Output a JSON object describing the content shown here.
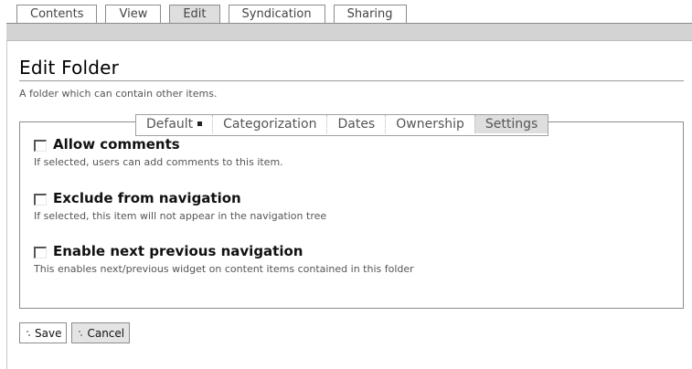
{
  "top_tabs": [
    {
      "label": "Contents",
      "active": false
    },
    {
      "label": "View",
      "active": false
    },
    {
      "label": "Edit",
      "active": true
    },
    {
      "label": "Syndication",
      "active": false
    },
    {
      "label": "Sharing",
      "active": false
    }
  ],
  "page": {
    "title": "Edit Folder",
    "description": "A folder which can contain other items."
  },
  "form_tabs": [
    {
      "label": "Default",
      "selected": false
    },
    {
      "label": "Categorization",
      "selected": false
    },
    {
      "label": "Dates",
      "selected": false
    },
    {
      "label": "Ownership",
      "selected": false
    },
    {
      "label": "Settings",
      "selected": true
    }
  ],
  "fields": [
    {
      "label": "Allow comments",
      "help": "If selected, users can add comments to this item.",
      "checked": false
    },
    {
      "label": "Exclude from navigation",
      "help": "If selected, this item will not appear in the navigation tree",
      "checked": false
    },
    {
      "label": "Enable next previous navigation",
      "help": "This enables next/previous widget on content items contained in this folder",
      "checked": false
    }
  ],
  "buttons": {
    "save_label": "Save",
    "cancel_label": "Cancel"
  }
}
